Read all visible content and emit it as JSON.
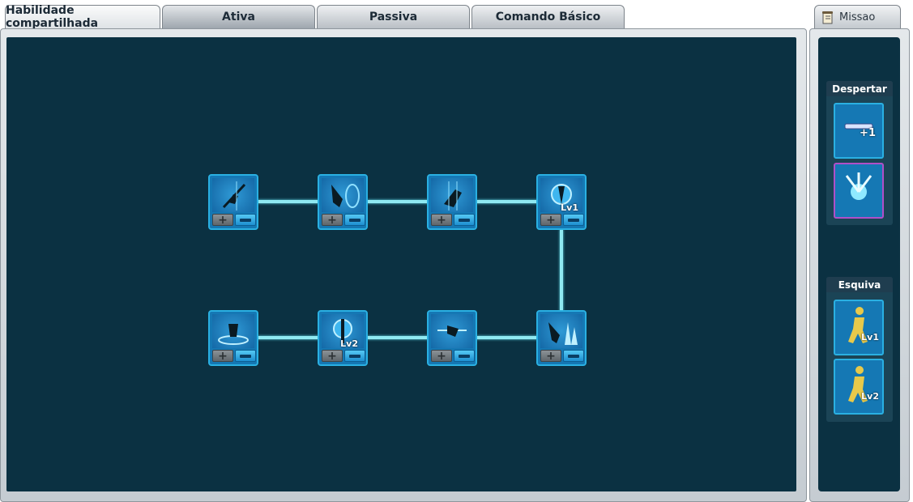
{
  "tabs": [
    {
      "label": "Habilidade compartilhada"
    },
    {
      "label": "Ativa"
    },
    {
      "label": "Passiva"
    },
    {
      "label": "Comando Básico"
    }
  ],
  "missao": {
    "label": "Missao",
    "icon": "quest-scroll-icon"
  },
  "skill_nodes": [
    {
      "icon": "spear-lunge-skill-icon",
      "level": ""
    },
    {
      "icon": "shield-strike-skill-icon",
      "level": ""
    },
    {
      "icon": "leap-attack-skill-icon",
      "level": ""
    },
    {
      "icon": "energy-orb-skill-icon",
      "level": "Lv1"
    },
    {
      "icon": "spin-vortex-skill-icon",
      "level": ""
    },
    {
      "icon": "energy-pillar-skill-icon",
      "level": "Lv2"
    },
    {
      "icon": "dash-slash-skill-icon",
      "level": ""
    },
    {
      "icon": "ice-spike-skill-icon",
      "level": ""
    }
  ],
  "sidebar": {
    "despertar": {
      "title": "Despertar",
      "cards": [
        {
          "icon": "awakening-gauge-icon",
          "badge": "+1"
        },
        {
          "icon": "awakening-burst-icon",
          "badge": ""
        }
      ]
    },
    "esquiva": {
      "title": "Esquiva",
      "cards": [
        {
          "icon": "dodge-figure-icon",
          "level": "Lv1"
        },
        {
          "icon": "dodge-figure-icon",
          "level": "Lv2"
        }
      ]
    }
  },
  "colors": {
    "board_bg": "#0b3142",
    "connector": "#8fe9f2",
    "node_border": "#2ab0e2",
    "minus_button": "#2ea9e4",
    "awakening_highlight": "#b04fc8",
    "dodge_figure": "#e8c94a"
  }
}
